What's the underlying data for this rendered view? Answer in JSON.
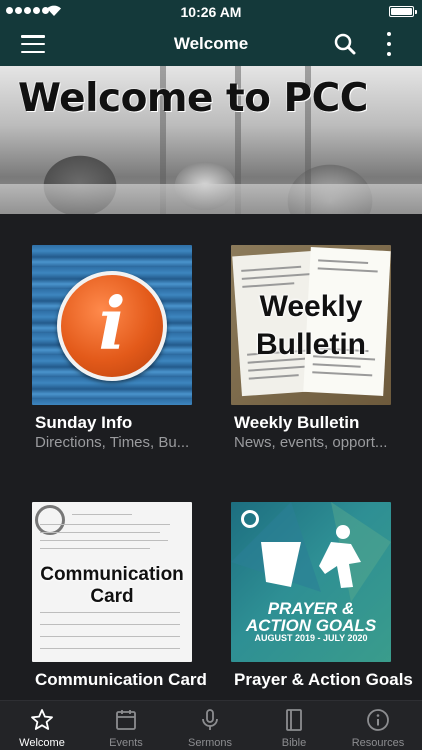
{
  "status_bar": {
    "time": "10:26 AM"
  },
  "header": {
    "title": "Welcome"
  },
  "hero": {
    "title": "Welcome to PCC"
  },
  "tiles": [
    {
      "title": "Sunday Info",
      "subtitle": "Directions, Times, Bu...",
      "image_text": "i"
    },
    {
      "title": "Weekly Bulletin",
      "subtitle": "News, events, opport...",
      "image_text_1": "Weekly",
      "image_text_2": "Bulletin"
    },
    {
      "title": "Communication Card",
      "image_text_1": "Communication",
      "image_text_2": "Card"
    },
    {
      "title": "Prayer & Action Goals",
      "image_text_1": "PRAYER &",
      "image_text_2": "ACTION GOALS",
      "image_text_3": "AUGUST 2019 - JULY 2020"
    }
  ],
  "tabs": [
    {
      "label": "Welcome",
      "icon": "star-icon",
      "active": true
    },
    {
      "label": "Events",
      "icon": "calendar-icon",
      "active": false
    },
    {
      "label": "Sermons",
      "icon": "microphone-icon",
      "active": false
    },
    {
      "label": "Bible",
      "icon": "book-icon",
      "active": false
    },
    {
      "label": "Resources",
      "icon": "info-icon",
      "active": false
    }
  ],
  "colors": {
    "header_bg": "#14393a",
    "page_bg": "#1c1d20",
    "tabbar_bg": "#232427",
    "inactive_tab": "#8c8d90"
  }
}
